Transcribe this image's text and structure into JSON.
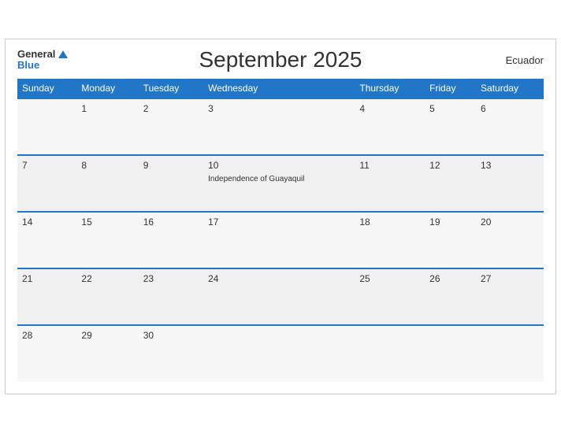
{
  "header": {
    "title": "September 2025",
    "country": "Ecuador",
    "logo_general": "General",
    "logo_blue": "Blue"
  },
  "weekdays": [
    "Sunday",
    "Monday",
    "Tuesday",
    "Wednesday",
    "Thursday",
    "Friday",
    "Saturday"
  ],
  "weeks": [
    [
      {
        "day": "",
        "event": ""
      },
      {
        "day": "1",
        "event": ""
      },
      {
        "day": "2",
        "event": ""
      },
      {
        "day": "3",
        "event": ""
      },
      {
        "day": "4",
        "event": ""
      },
      {
        "day": "5",
        "event": ""
      },
      {
        "day": "6",
        "event": ""
      }
    ],
    [
      {
        "day": "7",
        "event": ""
      },
      {
        "day": "8",
        "event": ""
      },
      {
        "day": "9",
        "event": ""
      },
      {
        "day": "10",
        "event": "Independence of Guayaquil"
      },
      {
        "day": "11",
        "event": ""
      },
      {
        "day": "12",
        "event": ""
      },
      {
        "day": "13",
        "event": ""
      }
    ],
    [
      {
        "day": "14",
        "event": ""
      },
      {
        "day": "15",
        "event": ""
      },
      {
        "day": "16",
        "event": ""
      },
      {
        "day": "17",
        "event": ""
      },
      {
        "day": "18",
        "event": ""
      },
      {
        "day": "19",
        "event": ""
      },
      {
        "day": "20",
        "event": ""
      }
    ],
    [
      {
        "day": "21",
        "event": ""
      },
      {
        "day": "22",
        "event": ""
      },
      {
        "day": "23",
        "event": ""
      },
      {
        "day": "24",
        "event": ""
      },
      {
        "day": "25",
        "event": ""
      },
      {
        "day": "26",
        "event": ""
      },
      {
        "day": "27",
        "event": ""
      }
    ],
    [
      {
        "day": "28",
        "event": ""
      },
      {
        "day": "29",
        "event": ""
      },
      {
        "day": "30",
        "event": ""
      },
      {
        "day": "",
        "event": ""
      },
      {
        "day": "",
        "event": ""
      },
      {
        "day": "",
        "event": ""
      },
      {
        "day": "",
        "event": ""
      }
    ]
  ]
}
